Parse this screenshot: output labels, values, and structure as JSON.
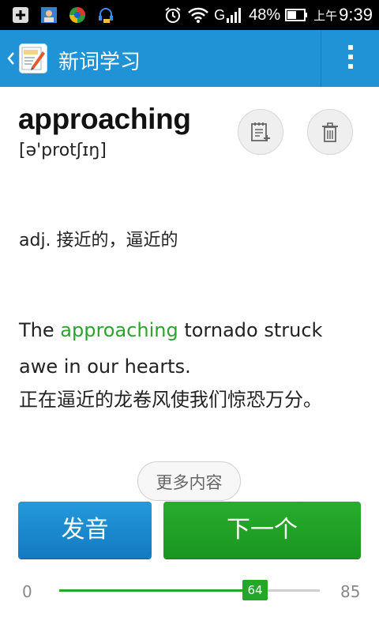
{
  "status_bar": {
    "battery": "48%",
    "clock_prefix": "上午",
    "time": "9:39",
    "network": "G",
    "icons": [
      "add-icon",
      "contacts-icon",
      "browser-icon",
      "headset-icon",
      "alarm-icon",
      "wifi-icon",
      "signal-icon",
      "battery-icon"
    ]
  },
  "action_bar": {
    "title": "新词学习",
    "color": "#1f93d6"
  },
  "word": {
    "term": "approaching",
    "phonetic": "[ə'protʃɪŋ]",
    "definition": "adj. 接近的，逼近的"
  },
  "example": {
    "before": "The ",
    "highlight": "approaching",
    "after": " tornado struck awe in our hearts.",
    "translation": "正在逼近的龙卷风使我们惊恐万分。",
    "highlight_color": "#2ea12e"
  },
  "more_button": "更多内容",
  "buttons": {
    "pronounce": "发音",
    "next": "下一个"
  },
  "progress": {
    "min": "0",
    "max": "85",
    "current": "64",
    "value": 64,
    "max_value": 85
  }
}
